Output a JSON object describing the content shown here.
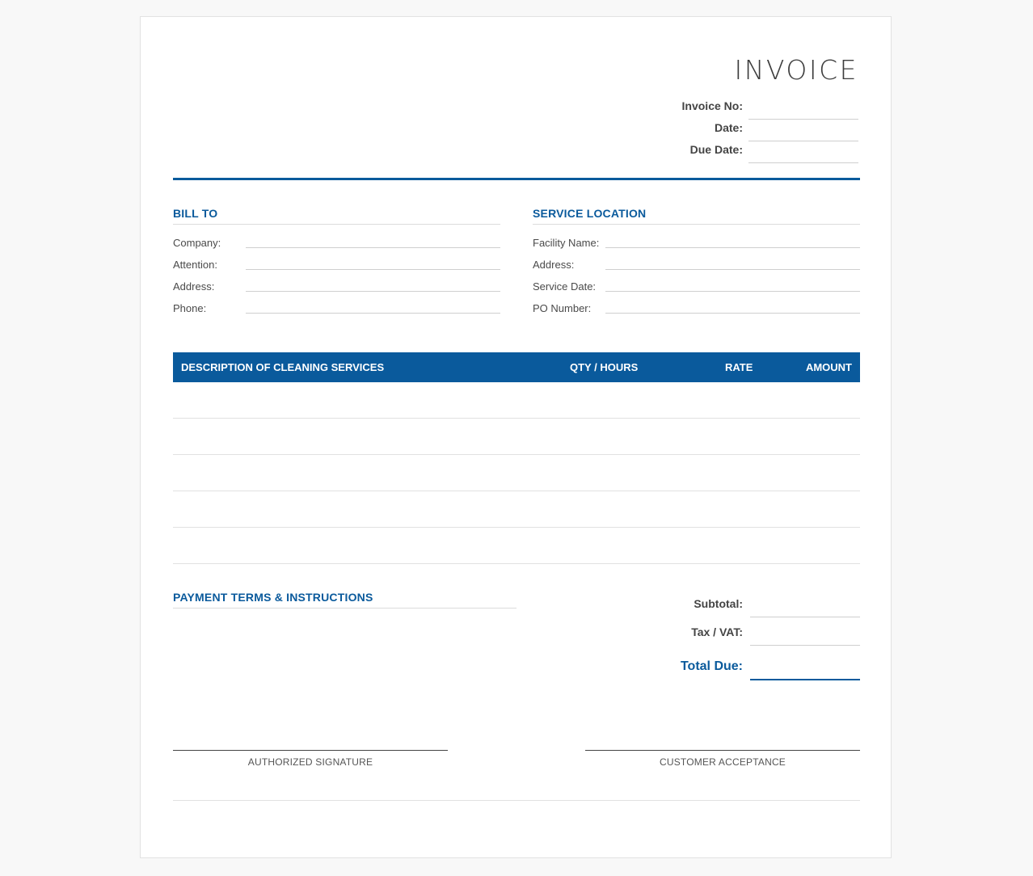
{
  "invoice": {
    "title": "INVOICE",
    "meta": {
      "invoice_no_label": "Invoice No:",
      "date_label": "Date:",
      "due_date_label": "Due Date:"
    }
  },
  "bill_to": {
    "title": "BILL TO",
    "fields": [
      "Company:",
      "Attention:",
      "Address:",
      "Phone:"
    ]
  },
  "service_location": {
    "title": "SERVICE LOCATION",
    "fields": [
      "Facility Name:",
      "Address:",
      "Service Date:",
      "PO Number:"
    ]
  },
  "items_table": {
    "columns": [
      "DESCRIPTION OF CLEANING SERVICES",
      "QTY / HOURS",
      "RATE",
      "AMOUNT"
    ],
    "row_count": 5
  },
  "payment_terms": {
    "title": "PAYMENT TERMS & INSTRUCTIONS"
  },
  "totals": {
    "subtotal_label": "Subtotal:",
    "tax_label": "Tax / VAT:",
    "total_due_label": "Total Due:"
  },
  "signatures": {
    "authorized": "AUTHORIZED SIGNATURE",
    "customer": "CUSTOMER ACCEPTANCE"
  },
  "colors": {
    "accent": "#0a5a9c",
    "page_background": "#f8f8f8",
    "sheet": "#ffffff"
  }
}
